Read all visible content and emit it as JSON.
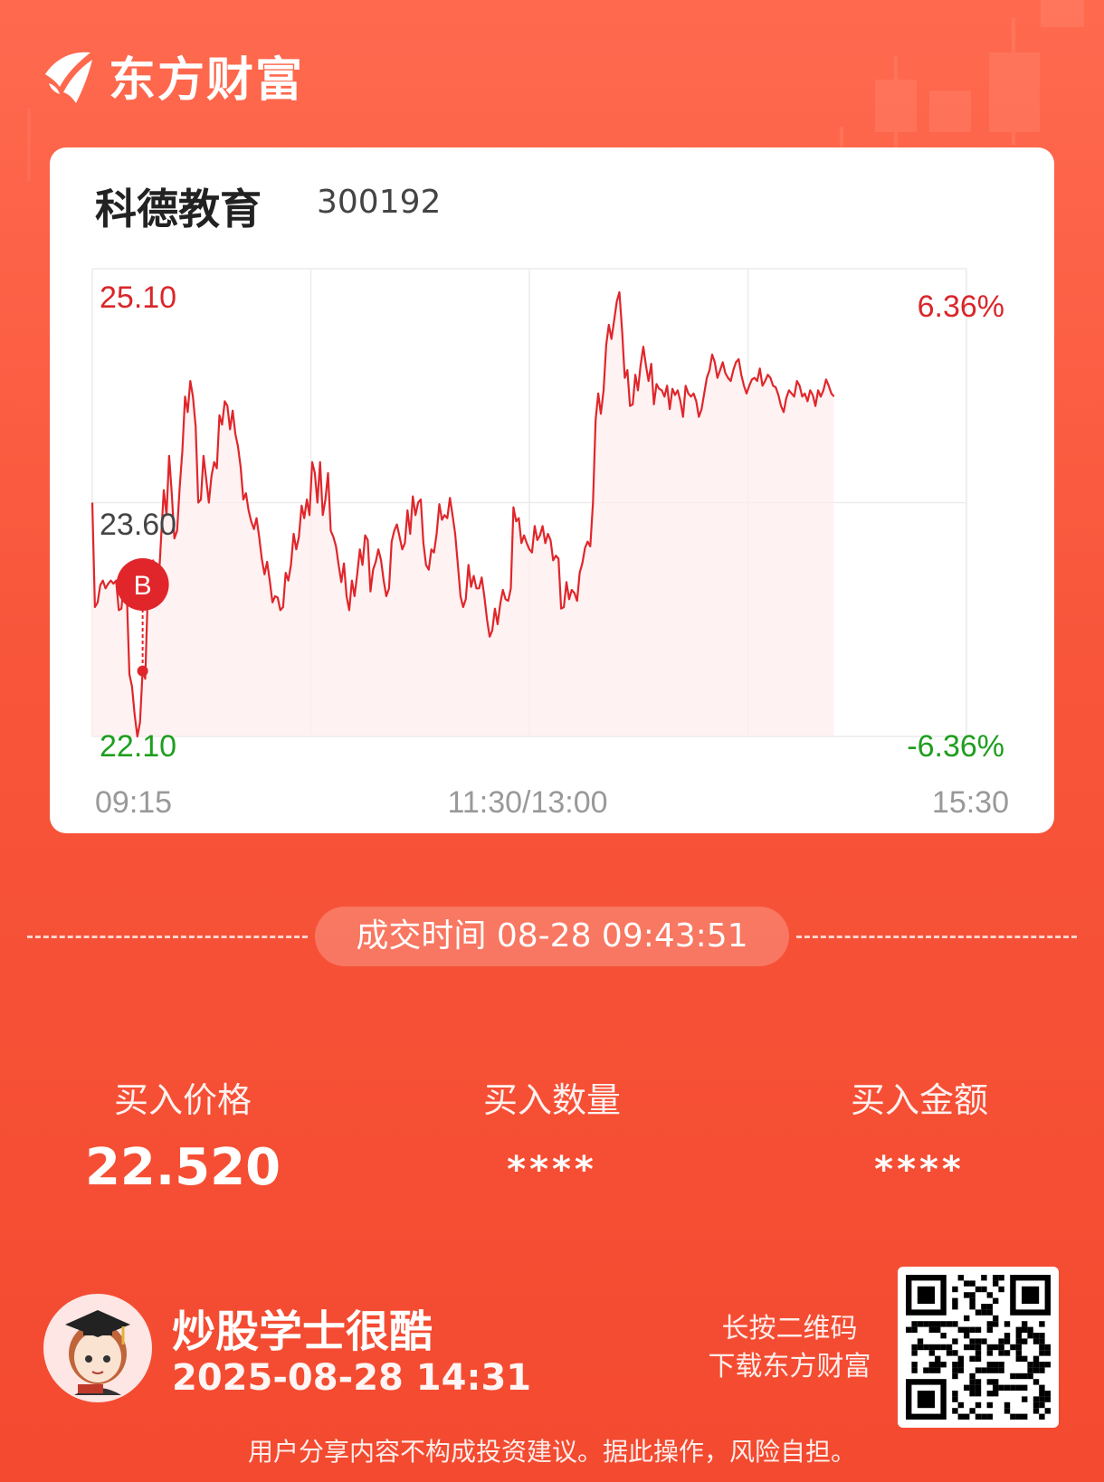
{
  "app": {
    "logo_text": "东方财富"
  },
  "stock": {
    "name": "科德教育",
    "code": "300192"
  },
  "chart_data": {
    "type": "line",
    "title": "",
    "x_start": "09:15",
    "x_mid": "11:30/13:00",
    "x_end": "15:30",
    "y_max": 25.1,
    "y_mid": 23.6,
    "y_min": 22.1,
    "pct_max": "6.36%",
    "pct_min": "-6.36%",
    "y_labels": {
      "max": "25.10",
      "mid": "23.60",
      "min": "22.10"
    },
    "marker": {
      "label": "B",
      "time": "09:43",
      "price": 22.52
    },
    "series": [
      {
        "values": [
          23.6,
          22.93,
          22.96,
          23.07,
          23.1,
          23.05,
          23.08,
          23.1,
          23.08,
          23.1,
          22.91,
          22.92,
          23.13,
          23.02,
          22.5,
          22.42,
          22.24,
          22.1,
          22.19,
          22.52,
          22.47,
          23.06,
          22.95,
          23.23,
          23.03,
          23.07,
          23.38,
          23.68,
          23.52,
          23.9,
          23.66,
          23.37,
          23.42,
          23.7,
          23.93,
          24.28,
          24.18,
          24.38,
          24.28,
          24.09,
          23.6,
          23.62,
          23.9,
          23.75,
          23.6,
          23.77,
          23.86,
          23.82,
          24.16,
          24.1,
          24.25,
          24.22,
          24.07,
          24.19,
          24.04,
          23.96,
          23.83,
          23.62,
          23.66,
          23.55,
          23.48,
          23.43,
          23.5,
          23.38,
          23.24,
          23.14,
          23.22,
          23.1,
          22.96,
          23.0,
          22.99,
          22.91,
          22.93,
          23.15,
          23.1,
          23.2,
          23.4,
          23.3,
          23.38,
          23.58,
          23.5,
          23.62,
          23.52,
          23.86,
          23.79,
          23.6,
          23.86,
          23.52,
          23.62,
          23.79,
          23.42,
          23.38,
          23.32,
          23.2,
          23.09,
          23.21,
          23.0,
          22.91,
          23.1,
          23.0,
          23.14,
          23.3,
          23.2,
          23.39,
          23.36,
          23.03,
          23.17,
          23.22,
          23.3,
          23.23,
          23.1,
          23.0,
          23.05,
          23.35,
          23.42,
          23.46,
          23.38,
          23.3,
          23.34,
          23.55,
          23.4,
          23.64,
          23.52,
          23.6,
          23.62,
          23.34,
          23.2,
          23.17,
          23.3,
          23.28,
          23.4,
          23.59,
          23.49,
          23.52,
          23.5,
          23.63,
          23.52,
          23.4,
          23.2,
          23.0,
          22.93,
          22.98,
          23.2,
          23.06,
          23.13,
          23.05,
          23.05,
          23.12,
          23.0,
          22.85,
          22.74,
          22.78,
          22.92,
          22.82,
          22.95,
          23.04,
          22.98,
          22.97,
          23.05,
          23.57,
          23.48,
          23.5,
          23.34,
          23.39,
          23.34,
          23.3,
          23.28,
          23.45,
          23.36,
          23.39,
          23.45,
          23.34,
          23.4,
          23.36,
          23.23,
          23.26,
          23.24,
          22.92,
          22.93,
          23.09,
          22.98,
          23.04,
          23.02,
          22.97,
          23.15,
          23.21,
          23.31,
          23.35,
          23.32,
          23.6,
          24.13,
          24.3,
          24.17,
          24.32,
          24.61,
          24.74,
          24.65,
          24.77,
          24.89,
          24.95,
          24.7,
          24.4,
          24.45,
          24.22,
          24.23,
          24.42,
          24.32,
          24.48,
          24.6,
          24.48,
          24.38,
          24.49,
          24.23,
          24.36,
          24.33,
          24.32,
          24.28,
          24.35,
          24.2,
          24.33,
          24.29,
          24.32,
          24.25,
          24.15,
          24.35,
          24.3,
          24.28,
          24.3,
          24.25,
          24.15,
          24.2,
          24.3,
          24.4,
          24.45,
          24.55,
          24.5,
          24.4,
          24.45,
          24.5,
          24.43,
          24.4,
          24.38,
          24.45,
          24.5,
          24.52,
          24.42,
          24.35,
          24.3,
          24.35,
          24.39,
          24.4,
          24.38,
          24.46,
          24.35,
          24.38,
          24.42,
          24.4,
          24.35,
          24.34,
          24.29,
          24.22,
          24.18,
          24.27,
          24.32,
          24.3,
          24.28,
          24.38,
          24.35,
          24.28,
          24.3,
          24.25,
          24.32,
          24.29,
          24.22,
          24.32,
          24.28,
          24.32,
          24.39,
          24.35,
          24.3,
          24.28
        ]
      }
    ]
  },
  "trade": {
    "time_label": "成交时间",
    "time_value": "08-28 09:43:51",
    "price_label": "买入价格",
    "price_value": "22.520",
    "qty_label": "买入数量",
    "qty_value": "****",
    "amount_label": "买入金额",
    "amount_value": "****"
  },
  "user": {
    "name": "炒股学士很酷",
    "time": "2025-08-28 14:31"
  },
  "qr": {
    "hint_line1": "长按二维码",
    "hint_line2": "下载东方财富"
  },
  "disclaimer": "用户分享内容不构成投资建议。据此操作，风险自担。"
}
